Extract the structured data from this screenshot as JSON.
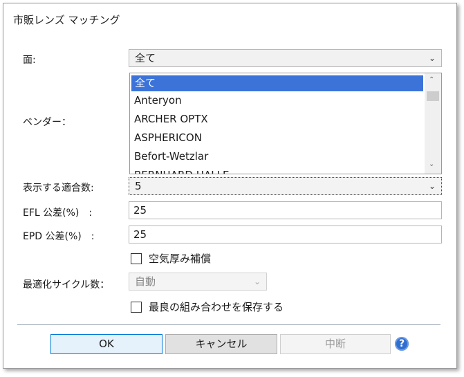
{
  "dialog": {
    "title": "市販レンズ マッチング"
  },
  "face": {
    "label": "面:",
    "value": "全て"
  },
  "vendor": {
    "label": "ベンダー：",
    "items": [
      "全て",
      "Anteryon",
      "ARCHER OPTX",
      "ASPHERICON",
      "Befort-Wetzlar",
      "BERNHARD HALLE"
    ],
    "selected_index": 0
  },
  "match_count": {
    "label": "表示する適合数:",
    "value": "5"
  },
  "efl": {
    "label": "EFL 公差(%)　:",
    "value": "25"
  },
  "epd": {
    "label": "EPD 公差(%)　:",
    "value": "25"
  },
  "air_thickness": {
    "label": "空気厚み補償",
    "checked": false
  },
  "cycles": {
    "label": "最適化サイクル数：",
    "value": "自動"
  },
  "save_best": {
    "label": "最良の組み合わせを保存する",
    "checked": false
  },
  "buttons": {
    "ok": "OK",
    "cancel": "キャンセル",
    "abort": "中断",
    "help": "?"
  },
  "colors": {
    "selection": "#3b73d9",
    "help": "#2f6fcf",
    "default_button_border": "#0078d7"
  }
}
